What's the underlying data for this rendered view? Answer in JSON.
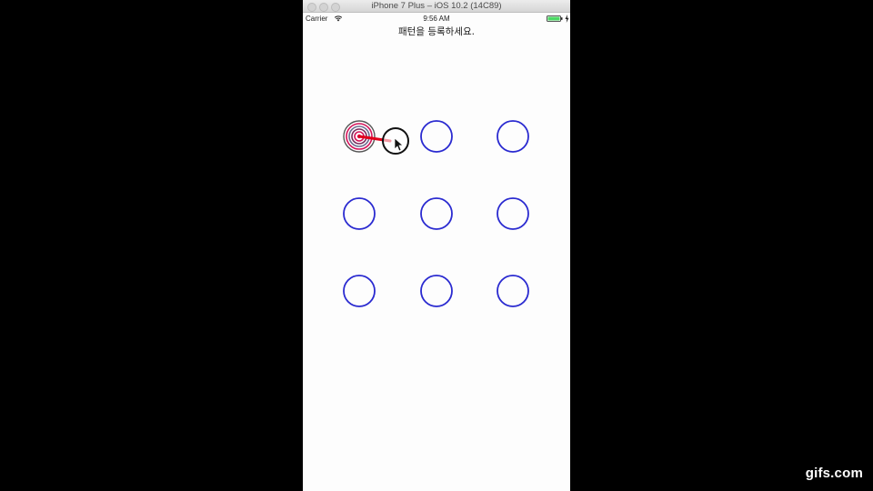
{
  "window": {
    "title": "iPhone 7 Plus – iOS 10.2 (14C89)"
  },
  "status_bar": {
    "carrier": "Carrier",
    "time": "9:56 AM",
    "battery_color": "#4cd964"
  },
  "screen": {
    "prompt": "패턴을 등록하세요."
  },
  "pattern": {
    "rows": 3,
    "columns": 3,
    "node_color": "#2a2ad0",
    "selected_node_colors": [
      "#d4145a",
      "#6b6b8f",
      "#7a2a5a"
    ],
    "selected_nodes": [
      1
    ],
    "line_color": "#e0001a",
    "cursor_color": "#111111"
  },
  "watermark": {
    "text": "gifs.com"
  }
}
